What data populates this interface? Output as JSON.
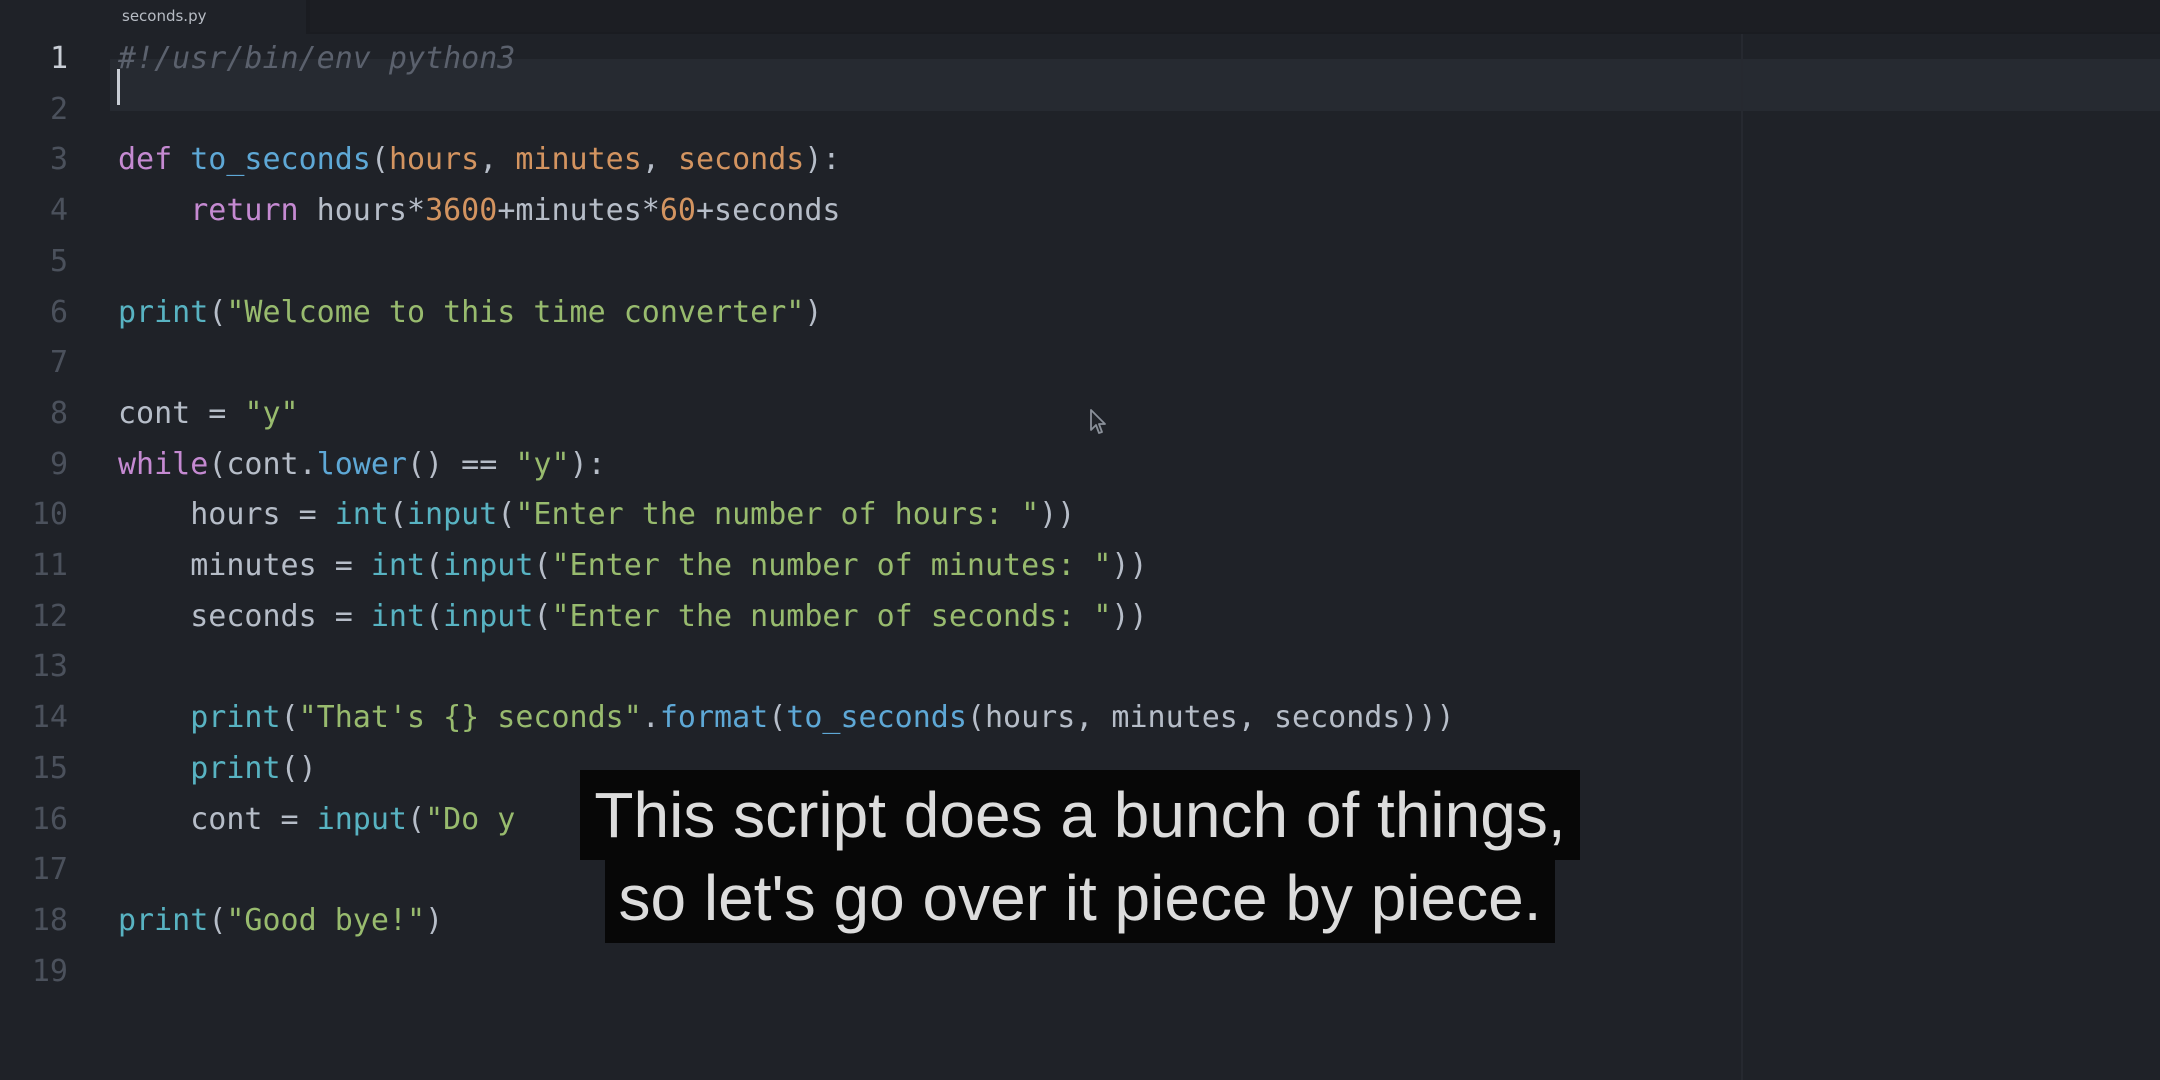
{
  "tab": {
    "label": "seconds.py"
  },
  "line_numbers": [
    "1",
    "2",
    "3",
    "4",
    "5",
    "6",
    "7",
    "8",
    "9",
    "10",
    "11",
    "12",
    "13",
    "14",
    "15",
    "16",
    "17",
    "18",
    "19"
  ],
  "code": [
    [
      {
        "t": "#!/usr/bin/env python3",
        "c": "c"
      }
    ],
    [],
    [
      {
        "t": "def ",
        "c": "k"
      },
      {
        "t": "to_seconds",
        "c": "f"
      },
      {
        "t": "(",
        "c": "o"
      },
      {
        "t": "hours",
        "c": "p"
      },
      {
        "t": ", ",
        "c": "o"
      },
      {
        "t": "minutes",
        "c": "p"
      },
      {
        "t": ", ",
        "c": "o"
      },
      {
        "t": "seconds",
        "c": "p"
      },
      {
        "t": "):",
        "c": "o"
      }
    ],
    [
      {
        "t": "    ",
        "c": "o"
      },
      {
        "t": "return",
        "c": "k"
      },
      {
        "t": " hours*",
        "c": "o"
      },
      {
        "t": "3600",
        "c": "n"
      },
      {
        "t": "+minutes*",
        "c": "o"
      },
      {
        "t": "60",
        "c": "n"
      },
      {
        "t": "+seconds",
        "c": "o"
      }
    ],
    [],
    [
      {
        "t": "print",
        "c": "b"
      },
      {
        "t": "(",
        "c": "o"
      },
      {
        "t": "\"Welcome to this time converter\"",
        "c": "s"
      },
      {
        "t": ")",
        "c": "o"
      }
    ],
    [],
    [
      {
        "t": "cont = ",
        "c": "o"
      },
      {
        "t": "\"y\"",
        "c": "s"
      }
    ],
    [
      {
        "t": "while",
        "c": "k"
      },
      {
        "t": "(cont.",
        "c": "o"
      },
      {
        "t": "lower",
        "c": "f"
      },
      {
        "t": "() == ",
        "c": "o"
      },
      {
        "t": "\"y\"",
        "c": "s"
      },
      {
        "t": "):",
        "c": "o"
      }
    ],
    [
      {
        "t": "    hours = ",
        "c": "o"
      },
      {
        "t": "int",
        "c": "b"
      },
      {
        "t": "(",
        "c": "o"
      },
      {
        "t": "input",
        "c": "b"
      },
      {
        "t": "(",
        "c": "o"
      },
      {
        "t": "\"Enter the number of hours: \"",
        "c": "s"
      },
      {
        "t": "))",
        "c": "o"
      }
    ],
    [
      {
        "t": "    minutes = ",
        "c": "o"
      },
      {
        "t": "int",
        "c": "b"
      },
      {
        "t": "(",
        "c": "o"
      },
      {
        "t": "input",
        "c": "b"
      },
      {
        "t": "(",
        "c": "o"
      },
      {
        "t": "\"Enter the number of minutes: \"",
        "c": "s"
      },
      {
        "t": "))",
        "c": "o"
      }
    ],
    [
      {
        "t": "    seconds = ",
        "c": "o"
      },
      {
        "t": "int",
        "c": "b"
      },
      {
        "t": "(",
        "c": "o"
      },
      {
        "t": "input",
        "c": "b"
      },
      {
        "t": "(",
        "c": "o"
      },
      {
        "t": "\"Enter the number of seconds: \"",
        "c": "s"
      },
      {
        "t": "))",
        "c": "o"
      }
    ],
    [],
    [
      {
        "t": "    ",
        "c": "o"
      },
      {
        "t": "print",
        "c": "b"
      },
      {
        "t": "(",
        "c": "o"
      },
      {
        "t": "\"That's {} seconds\"",
        "c": "s"
      },
      {
        "t": ".",
        "c": "o"
      },
      {
        "t": "format",
        "c": "f"
      },
      {
        "t": "(",
        "c": "o"
      },
      {
        "t": "to_seconds",
        "c": "f"
      },
      {
        "t": "(hours, minutes, seconds)))",
        "c": "o"
      }
    ],
    [
      {
        "t": "    ",
        "c": "o"
      },
      {
        "t": "print",
        "c": "b"
      },
      {
        "t": "()",
        "c": "o"
      }
    ],
    [
      {
        "t": "    cont = ",
        "c": "o"
      },
      {
        "t": "input",
        "c": "b"
      },
      {
        "t": "(",
        "c": "o"
      },
      {
        "t": "\"Do y",
        "c": "s"
      },
      {
        "t": "                                             )",
        "c": "o"
      }
    ],
    [],
    [
      {
        "t": "print",
        "c": "b"
      },
      {
        "t": "(",
        "c": "o"
      },
      {
        "t": "\"Good bye!\"",
        "c": "s"
      },
      {
        "t": ")",
        "c": "o"
      }
    ],
    []
  ],
  "subtitles": {
    "line1": "This script does a bunch of things,",
    "line2": "so let's go over it piece by piece."
  },
  "colors": {
    "background": "#1f2228",
    "keyword": "#c58ad2",
    "function": "#5ea8d6",
    "builtin": "#58b3c2",
    "string": "#98bb6e",
    "number": "#d39460",
    "comment": "#5b616d"
  },
  "icons": {
    "cursor": "mouse-pointer-icon"
  }
}
